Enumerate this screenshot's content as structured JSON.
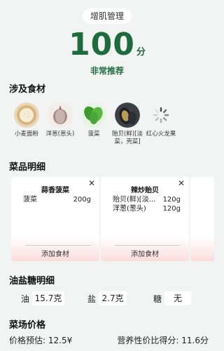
{
  "header": {
    "tag": "增肌管理",
    "score": "100",
    "score_unit": "分",
    "verdict": "非常推荐"
  },
  "sections": {
    "ingredients_title": "涉及食材",
    "dishes_title": "菜品明细",
    "osl_title": "油盐糖明细",
    "price_title": "菜场价格"
  },
  "ingredients": [
    {
      "label": "小麦面粉",
      "icon": "flour-icon"
    },
    {
      "label": "洋葱(葱头)",
      "icon": "onion-icon"
    },
    {
      "label": "菠菜",
      "icon": "spinach-icon"
    },
    {
      "label": "贻贝(鲜)[淡菜，壳菜]",
      "icon": "mussel-icon"
    },
    {
      "label": "红心火龙果",
      "icon": "loading-spinner-icon"
    }
  ],
  "dishes": [
    {
      "name": "蒜香菠菜",
      "items": [
        {
          "name": "菠菜",
          "qty": "200g"
        }
      ],
      "add_label": "添加食材"
    },
    {
      "name": "辣炒贻贝",
      "items": [
        {
          "name": "贻贝(鲜)[淡...",
          "qty": "120g"
        },
        {
          "name": "洋葱(葱头)",
          "qty": "120g"
        }
      ],
      "add_label": "添加食材"
    }
  ],
  "osl": {
    "oil_label": "油",
    "oil_value": "15.7克",
    "salt_label": "盐",
    "salt_value": "2.7克",
    "sugar_label": "糖",
    "sugar_value": "无"
  },
  "price": {
    "estimate": "价格预估: 12.5¥",
    "value_score": "营养性价比得分: 11.6分"
  },
  "colors": {
    "accent_green": "#1e6b3e",
    "page_bg": "#f2f3f3",
    "card_fade": "#fbdcdc"
  }
}
